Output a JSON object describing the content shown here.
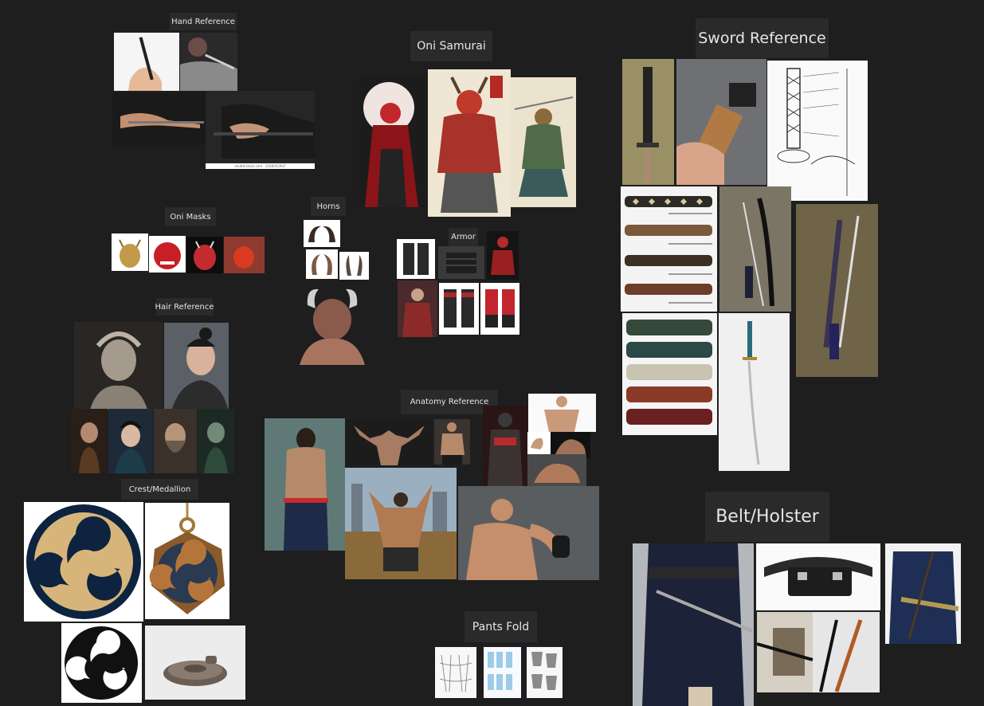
{
  "labels": {
    "hand": "Hand Reference",
    "oni_samurai": "Oni Samurai",
    "sword": "Sword Reference",
    "oni_masks": "Oni Masks",
    "horns": "Horns",
    "armor": "Armor",
    "hair": "Hair Reference",
    "anatomy": "Anatomy Reference",
    "crest": "Crest/Medallion",
    "pants": "Pants Fold",
    "belt": "Belt/Holster"
  },
  "watermark": "shutterstock.com · 2166052947",
  "colors": {
    "background": "#1e1e1e",
    "label_bg": "#2a2a2a",
    "label_text": "#e6e6e6",
    "crest_gold": "#d7b57a",
    "crest_navy": "#0d2340"
  }
}
